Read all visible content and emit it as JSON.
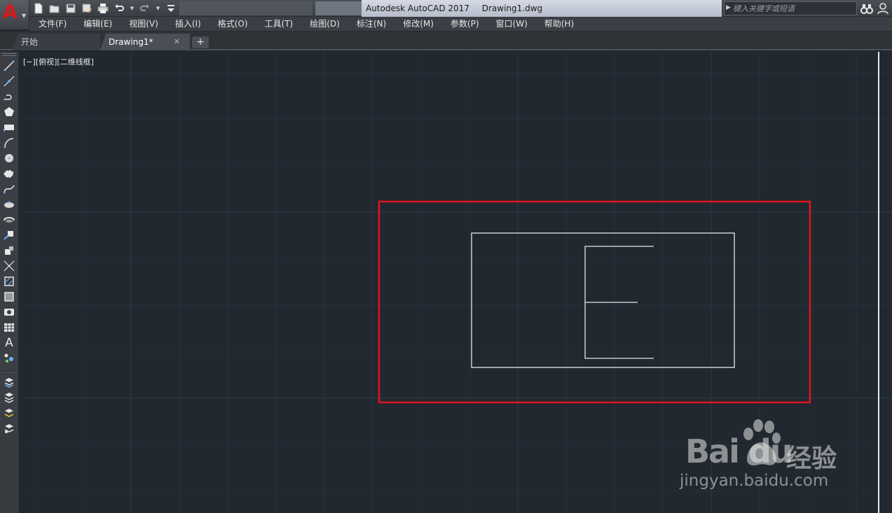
{
  "app": {
    "logo_letter": "A",
    "title_app": "Autodesk AutoCAD 2017",
    "title_file": "Drawing1.dwg"
  },
  "search": {
    "placeholder": "键入关键字或短语"
  },
  "menu": {
    "items": [
      {
        "label": "文件(F)"
      },
      {
        "label": "编辑(E)"
      },
      {
        "label": "视图(V)"
      },
      {
        "label": "插入(I)"
      },
      {
        "label": "格式(O)"
      },
      {
        "label": "工具(T)"
      },
      {
        "label": "绘图(D)"
      },
      {
        "label": "标注(N)"
      },
      {
        "label": "修改(M)"
      },
      {
        "label": "参数(P)"
      },
      {
        "label": "窗口(W)"
      },
      {
        "label": "帮助(H)"
      }
    ]
  },
  "tabs": {
    "start": "开始",
    "drawing": "Drawing1*",
    "close_glyph": "✕",
    "new_glyph": "+"
  },
  "viewport": {
    "label": "[−][俯视][二维线框]"
  },
  "toolbar": {
    "text_tool": "A"
  },
  "watermark": {
    "brand": "Bai du",
    "brand_cn": "经验",
    "url": "jingyan.baidu.com"
  },
  "colors": {
    "canvas": "#212830",
    "grid": "#2a323c",
    "geometry": "#e8e8e8",
    "highlight": "#e0141a",
    "logo": "#d8191c"
  }
}
